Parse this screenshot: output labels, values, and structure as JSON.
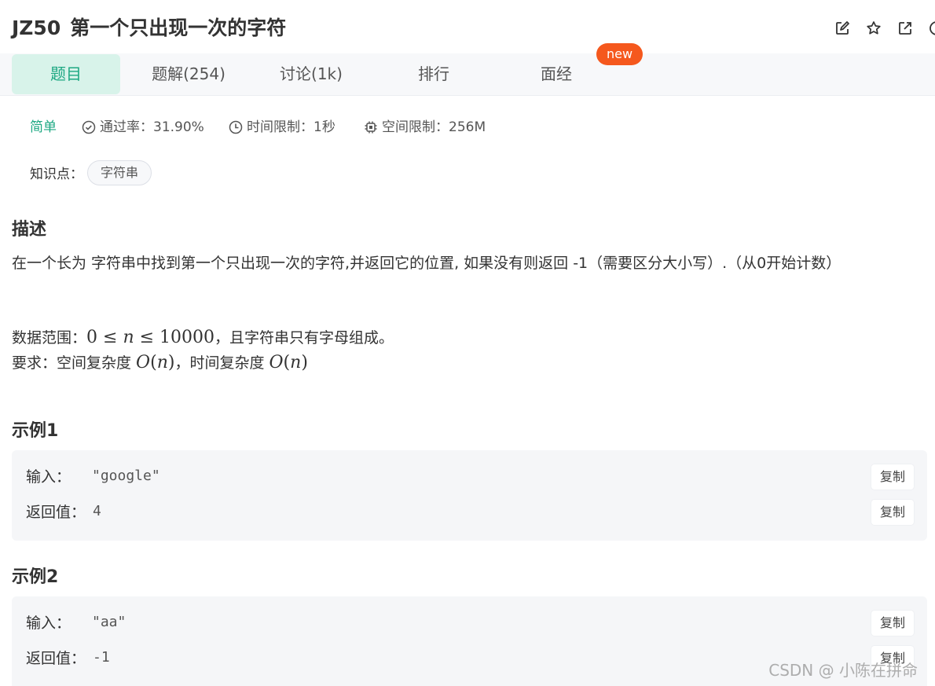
{
  "problem": {
    "code": "JZ50",
    "title": "第一个只出现一次的字符"
  },
  "toolbar": {
    "icons": [
      "edit-icon",
      "star-icon",
      "external-link-icon",
      "alert-icon"
    ]
  },
  "tabs": [
    {
      "label": "题目",
      "active": true
    },
    {
      "label": "题解(254)",
      "active": false
    },
    {
      "label": "讨论(1k)",
      "active": false
    },
    {
      "label": "排行",
      "active": false
    },
    {
      "label": "面经",
      "active": false
    }
  ],
  "new_badge": "new",
  "meta": {
    "difficulty": "简单",
    "pass_rate": "通过率：31.90%",
    "time_limit": "时间限制：1秒",
    "memory_limit": "空间限制：256M"
  },
  "knowledge": {
    "label": "知识点：",
    "tags": [
      "字符串"
    ]
  },
  "description": {
    "heading": "描述",
    "text": "在一个长为 字符串中找到第一个只出现一次的字符,并返回它的位置, 如果没有则返回 -1（需要区分大小写）.（从0开始计数）",
    "range_label": "数据范围：",
    "range_tail": "，且字符串只有字母组成。",
    "requirement_label": "要求：空间复杂度 ",
    "requirement_mid": "，时间复杂度 "
  },
  "examples": [
    {
      "heading": "示例1",
      "input_label": "输入：",
      "input_value": "\"google\"",
      "output_label": "返回值：",
      "output_value": "4",
      "copy_label": "复制"
    },
    {
      "heading": "示例2",
      "input_label": "输入：",
      "input_value": "\"aa\"",
      "output_label": "返回值：",
      "output_value": "-1",
      "copy_label": "复制"
    }
  ],
  "watermark": "CSDN @ 小陈在拼命",
  "colors": {
    "accent": "#1ea883",
    "active_tab_bg": "#d8f3ea",
    "badge": "#f5581d",
    "tabs_bg": "#f7f8fa",
    "example_bg": "#f5f6f8"
  }
}
